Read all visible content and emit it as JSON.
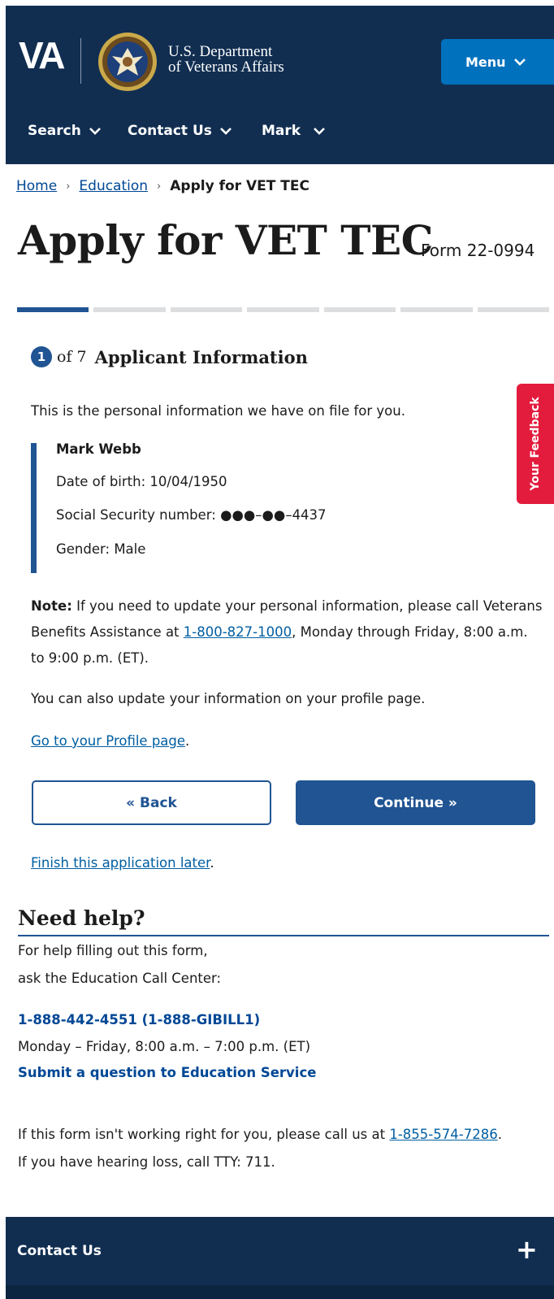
{
  "header": {
    "logo": "VA",
    "dept_line1": "U.S. Department",
    "dept_line2": "of Veterans Affairs",
    "menu_label": "Menu",
    "nav": [
      "Search",
      "Contact Us",
      "Mark"
    ],
    "colors": {
      "background": "#112e51",
      "menu_button": "#0071bc"
    }
  },
  "breadcrumb": {
    "items": [
      "Home",
      "Education"
    ],
    "current": "Apply for VET TEC"
  },
  "page": {
    "title": "Apply for VET TEC",
    "form_number": "Form 22-0994"
  },
  "progress": {
    "current_step": 1,
    "total_steps": 7
  },
  "step": {
    "number": "1",
    "of_text": "of 7",
    "title": "Applicant Information"
  },
  "intro": "This is the personal information we have on file for you.",
  "applicant": {
    "name": "Mark Webb",
    "dob": "Date of birth: 10/04/1950",
    "ssn": "Social Security number: ●●●–●●–4437",
    "gender": "Gender: Male"
  },
  "note": {
    "label": "Note:",
    "text_before": " If you need to update your personal information, please call Veterans Benefits Assistance at ",
    "phone": "1-800-827-1000",
    "text_after": ", Monday through Friday, 8:00 a.m. to 9:00 p.m. (ET)."
  },
  "profile": {
    "text": "You can also update your information on your profile page.",
    "link": "Go to your Profile page",
    "link_suffix": "."
  },
  "buttons": {
    "back": "« Back",
    "continue": "Continue »"
  },
  "finish": {
    "link": "Finish this application later",
    "suffix": "."
  },
  "help": {
    "heading": "Need help?",
    "line1": "For help filling out this form,",
    "line2": "ask the Education Call Center:",
    "phone": "1-888-442-4551 (1-888-GIBILL1)",
    "hours": "Monday – Friday, 8:00 a.m. – 7:00 p.m. (ET)",
    "question_link": "Submit a question to Education Service",
    "trouble_before": "If this form isn't working right for you, please call us at ",
    "trouble_phone": "1-855-574-7286",
    "trouble_after": ".",
    "tty": "If you have hearing loss, call TTY: 711."
  },
  "footer": {
    "contact_label": "Contact Us",
    "expand_symbol": "+"
  },
  "feedback": {
    "label": "Your Feedback",
    "color": "#e31c3d"
  }
}
